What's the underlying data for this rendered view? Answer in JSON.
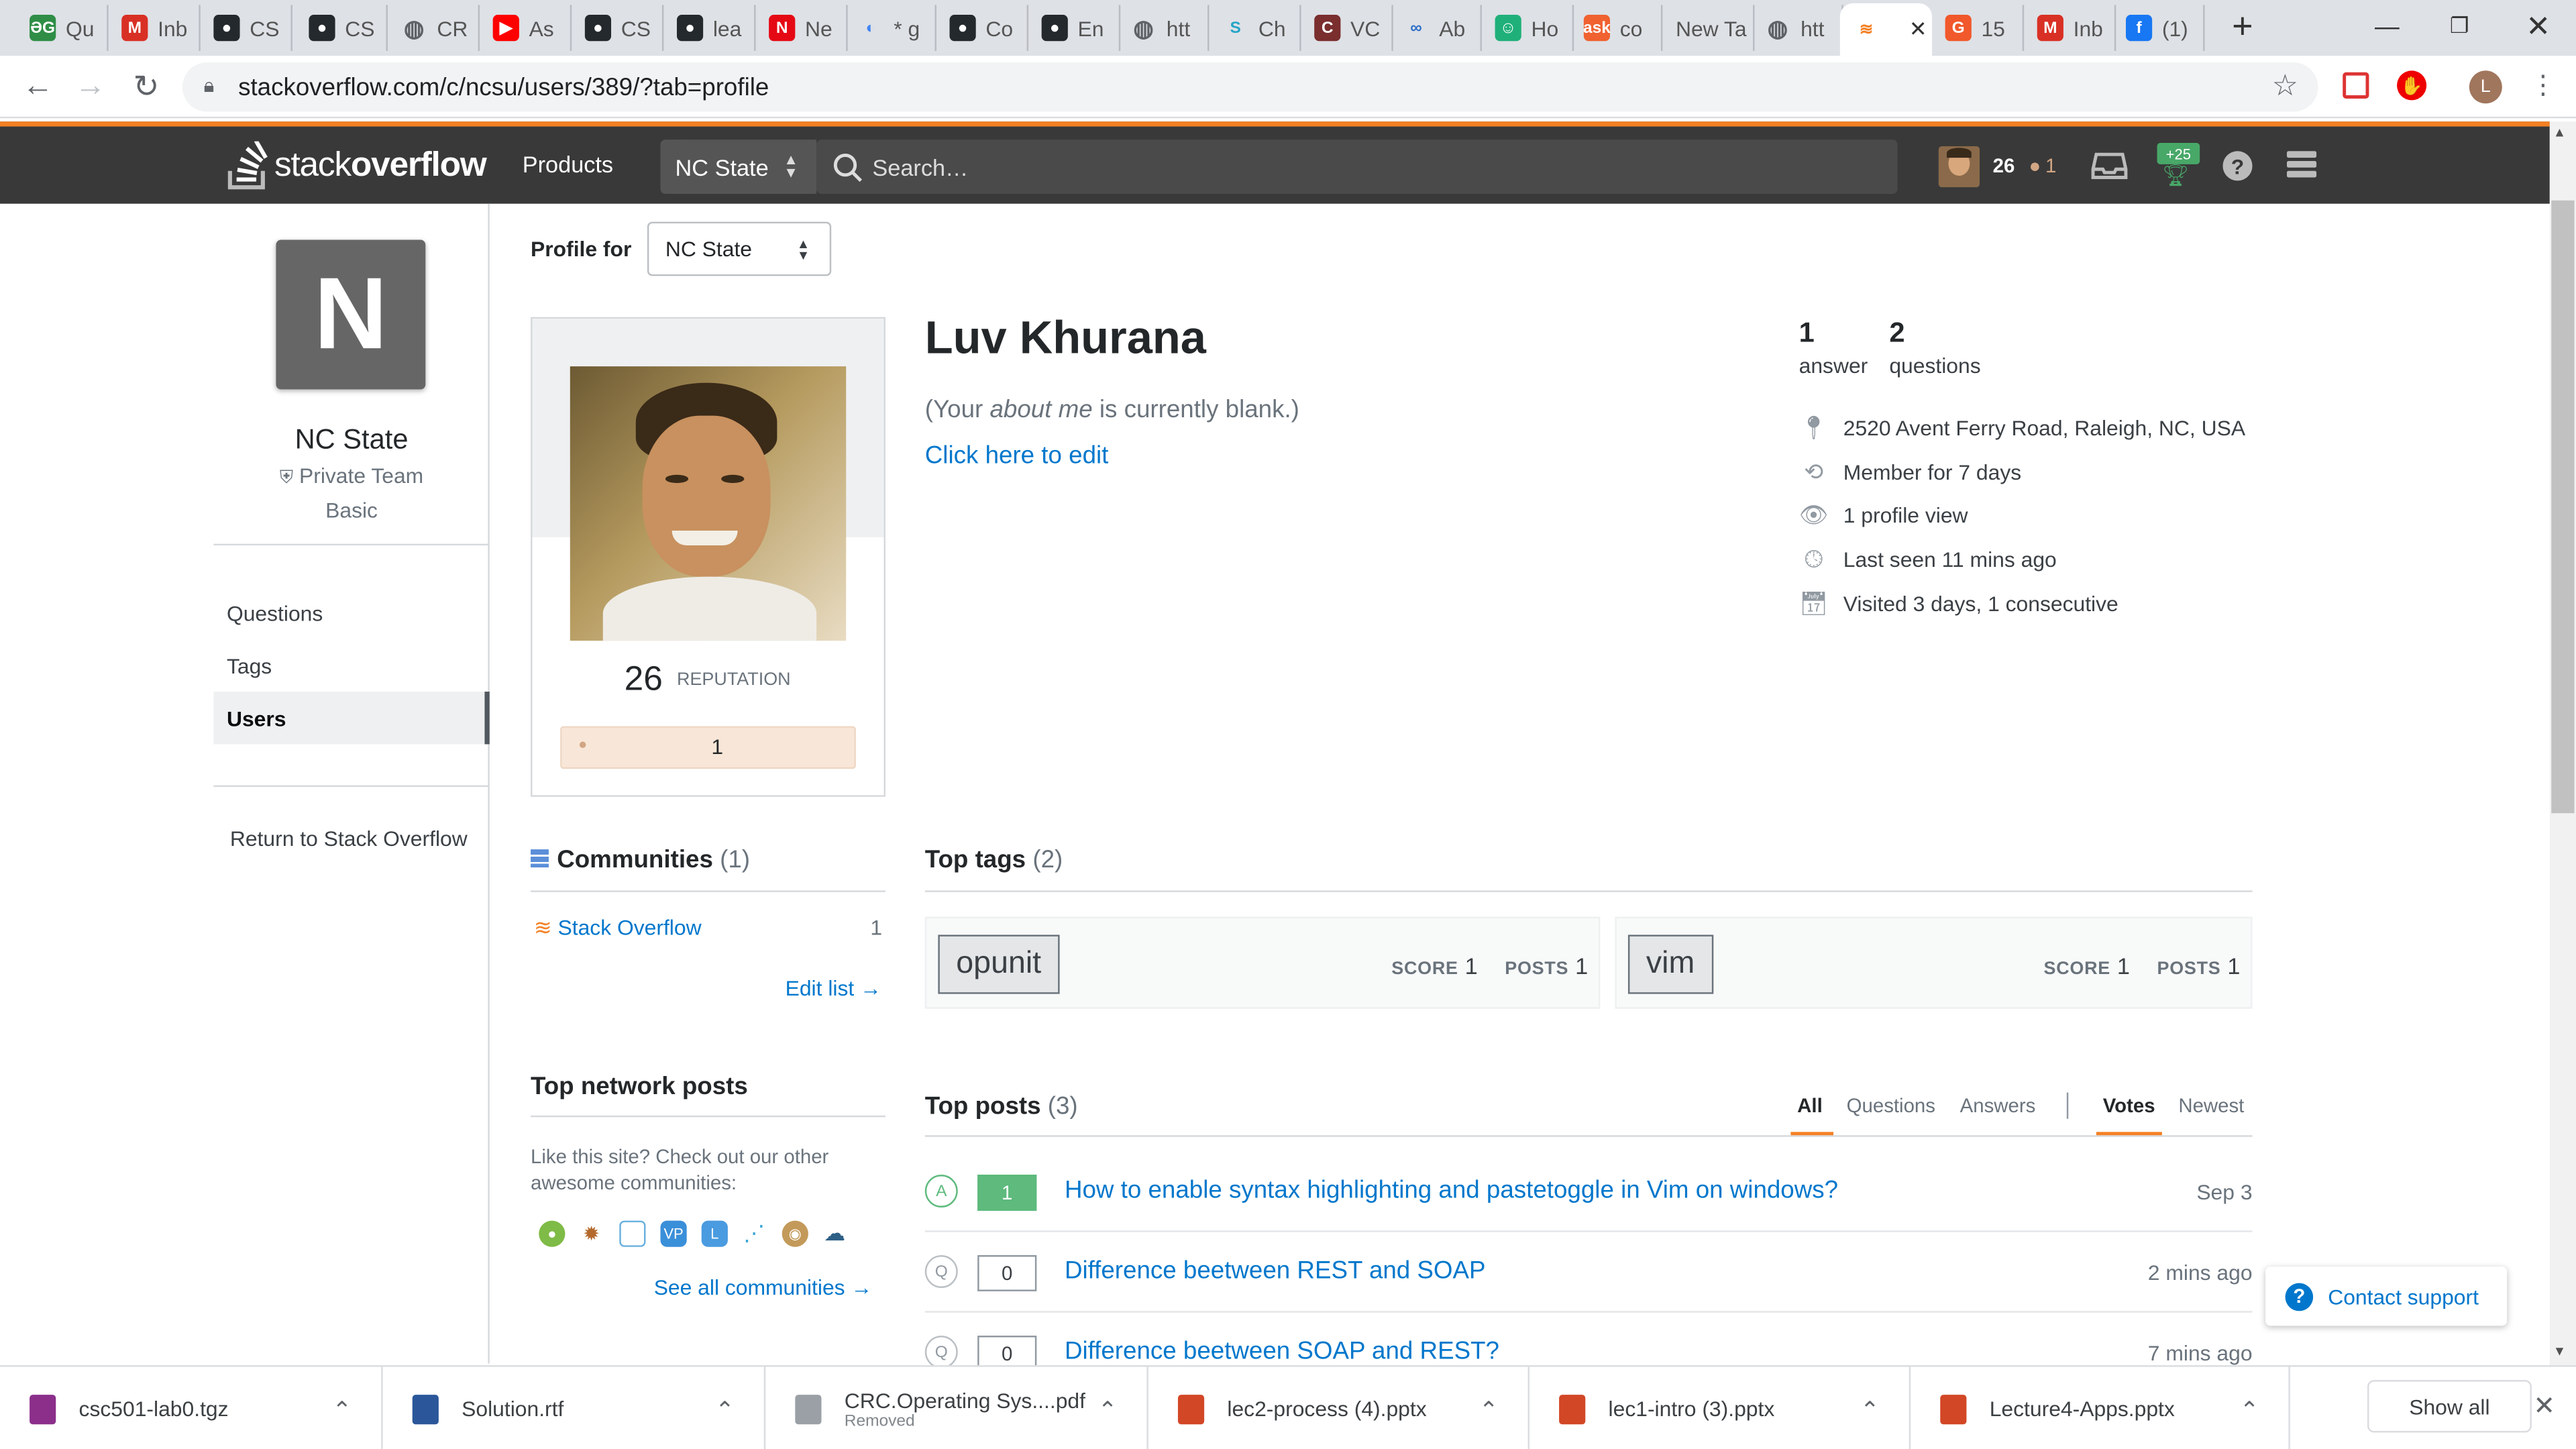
{
  "browser": {
    "tabs": [
      {
        "label": "Qu",
        "icon": "gfg-icon",
        "color": "#2f8d46",
        "glyph": "ƏG"
      },
      {
        "label": "Inb",
        "icon": "gmail-icon",
        "color": "#d93025",
        "glyph": "M"
      },
      {
        "label": "CS",
        "icon": "github-icon",
        "color": "#24292e",
        "glyph": "●"
      },
      {
        "label": "CS",
        "icon": "github-icon",
        "color": "#24292e",
        "glyph": "●"
      },
      {
        "label": "CR",
        "icon": "globe-icon",
        "color": "#5f6368",
        "glyph": "◍"
      },
      {
        "label": "As",
        "icon": "youtube-icon",
        "color": "#ff0000",
        "glyph": "▶"
      },
      {
        "label": "CS",
        "icon": "github-icon",
        "color": "#24292e",
        "glyph": "●"
      },
      {
        "label": "lea",
        "icon": "github-icon",
        "color": "#24292e",
        "glyph": "●"
      },
      {
        "label": "Ne",
        "icon": "netflix-icon",
        "color": "#e50914",
        "glyph": "N"
      },
      {
        "label": "* g",
        "icon": "refresh-icon",
        "color": "#4285f4",
        "glyph": "◐"
      },
      {
        "label": "Co",
        "icon": "github-icon",
        "color": "#24292e",
        "glyph": "●"
      },
      {
        "label": "En",
        "icon": "github-icon",
        "color": "#24292e",
        "glyph": "●"
      },
      {
        "label": "htt",
        "icon": "globe-icon",
        "color": "#5f6368",
        "glyph": "◍"
      },
      {
        "label": "Ch",
        "icon": "stack-icon",
        "color": "#25a5c7",
        "glyph": "S"
      },
      {
        "label": "VC",
        "icon": "cplusplus-icon",
        "color": "#7a2e2e",
        "glyph": "C"
      },
      {
        "label": "Ab",
        "icon": "infinity-icon",
        "color": "#2b6fc9",
        "glyph": "∞"
      },
      {
        "label": "Ho",
        "icon": "bot-icon",
        "color": "#1fb07a",
        "glyph": "☺"
      },
      {
        "label": "co",
        "icon": "askfm-icon",
        "color": "#f06230",
        "glyph": "ask"
      },
      {
        "label": "New Ta",
        "icon": "",
        "color": "",
        "glyph": ""
      },
      {
        "label": "htt",
        "icon": "globe-icon",
        "color": "#5f6368",
        "glyph": "◍"
      },
      {
        "label": "",
        "icon": "stackoverflow-icon",
        "color": "#f48024",
        "glyph": "≋"
      },
      {
        "label": "15",
        "icon": "grammarly-icon",
        "color": "#f1582b",
        "glyph": "G"
      },
      {
        "label": "Inb",
        "icon": "gmail-icon",
        "color": "#d93025",
        "glyph": "M"
      },
      {
        "label": "(1)",
        "icon": "facebook-icon",
        "color": "#1877f2",
        "glyph": "f"
      }
    ],
    "url": "stackoverflow.com/c/ncsu/users/389/?tab=profile",
    "profile_initial": "L"
  },
  "header": {
    "logo_text_plain": "stack",
    "logo_text_bold": "overflow",
    "products": "Products",
    "team_selector": "NC State",
    "search_placeholder": "Search…",
    "user_rep": "26",
    "user_bronze": "1",
    "achievements_badge": "+25",
    "accent": "#f48024"
  },
  "team": {
    "initial": "N",
    "name": "NC State",
    "type": "Private Team",
    "plan": "Basic"
  },
  "leftnav": {
    "questions": "Questions",
    "tags": "Tags",
    "users": "Users",
    "return": "Return to Stack Overflow"
  },
  "profile": {
    "profile_for_label": "Profile for",
    "profile_for_value": "NC State",
    "name": "Luv Khurana",
    "about_prefix": "(Your ",
    "about_em": "about me",
    "about_suffix": " is currently blank.)",
    "edit_link": "Click here to edit",
    "reputation": "26",
    "reputation_label": "REPUTATION",
    "bronze_count": "1",
    "answers_count": "1",
    "answers_label": "answer",
    "questions_count": "2",
    "questions_label": "questions",
    "location": "2520 Avent Ferry Road, Raleigh, NC, USA",
    "member_for": "Member for 7 days",
    "profile_views": "1 profile view",
    "last_seen": "Last seen 11 mins ago",
    "visited": "Visited 3 days, 1 consecutive"
  },
  "communities": {
    "title": "Communities",
    "count": "(1)",
    "items": [
      {
        "name": "Stack Overflow",
        "value": "1"
      }
    ],
    "edit": "Edit list →"
  },
  "network": {
    "title": "Top network posts",
    "text": "Like this site? Check out our other awesome communities:",
    "see_all": "See all communities →"
  },
  "top_tags": {
    "title": "Top tags",
    "count": "(2)",
    "score_label": "SCORE",
    "posts_label": "POSTS",
    "items": [
      {
        "name": "opunit",
        "score": "1",
        "posts": "1"
      },
      {
        "name": "vim",
        "score": "1",
        "posts": "1"
      }
    ]
  },
  "top_posts": {
    "title": "Top posts",
    "count": "(3)",
    "filters": [
      "All",
      "Questions",
      "Answers"
    ],
    "sorts": [
      "Votes",
      "Newest"
    ],
    "items": [
      {
        "type": "A",
        "votes": "1",
        "title": "How to enable syntax highlighting and pastetoggle in Vim on windows?",
        "date": "Sep 3"
      },
      {
        "type": "Q",
        "votes": "0",
        "title": "Difference beetween REST and SOAP",
        "date": "2 mins ago"
      },
      {
        "type": "Q",
        "votes": "0",
        "title": "Difference beetween SOAP and REST?",
        "date": "7 mins ago"
      }
    ]
  },
  "support": {
    "label": "Contact support"
  },
  "downloads": {
    "items": [
      {
        "name": "csc501-lab0.tgz",
        "sub": "",
        "color": "#8b2f8b"
      },
      {
        "name": "Solution.rtf",
        "sub": "",
        "color": "#2b579a"
      },
      {
        "name": "CRC.Operating Sys....pdf",
        "sub": "Removed",
        "color": "#9aa0a6"
      },
      {
        "name": "lec2-process (4).pptx",
        "sub": "",
        "color": "#d24726"
      },
      {
        "name": "lec1-intro (3).pptx",
        "sub": "",
        "color": "#d24726"
      },
      {
        "name": "Lecture4-Apps.pptx",
        "sub": "",
        "color": "#d24726"
      }
    ],
    "show_all": "Show all"
  }
}
